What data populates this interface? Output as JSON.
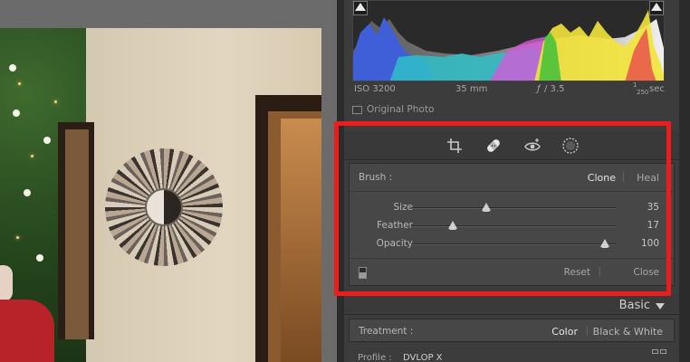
{
  "meta": {
    "iso": "ISO 3200",
    "focal_length": "35 mm",
    "aperture_f": "ƒ",
    "aperture_value": "/ 3.5",
    "shutter_num": "1",
    "shutter_den": "250",
    "shutter_unit": "sec"
  },
  "original_photo_label": "Original Photo",
  "tools": [
    {
      "name": "crop-tool-icon"
    },
    {
      "name": "spot-removal-tool-icon"
    },
    {
      "name": "red-eye-tool-icon"
    },
    {
      "name": "mask-tool-icon"
    }
  ],
  "brush": {
    "label": "Brush :",
    "mode_clone": "Clone",
    "mode_heal": "Heal"
  },
  "sliders": [
    {
      "label": "Size",
      "value": "35",
      "fraction": 0.35
    },
    {
      "label": "Feather",
      "value": "17",
      "fraction": 0.17
    },
    {
      "label": "Opacity",
      "value": "100",
      "fraction": 1.0
    }
  ],
  "footer": {
    "reset": "Reset",
    "close": "Close"
  },
  "basic": {
    "title": "Basic",
    "treatment_label": "Treatment :",
    "treatment_color": "Color",
    "treatment_bw": "Black & White",
    "profile_label": "Profile :",
    "profile_value": "DVLOP X"
  },
  "colors": {
    "highlight": "#ee1c1c",
    "panel_bg": "#3c3c3c",
    "subpanel_bg": "#474747"
  }
}
